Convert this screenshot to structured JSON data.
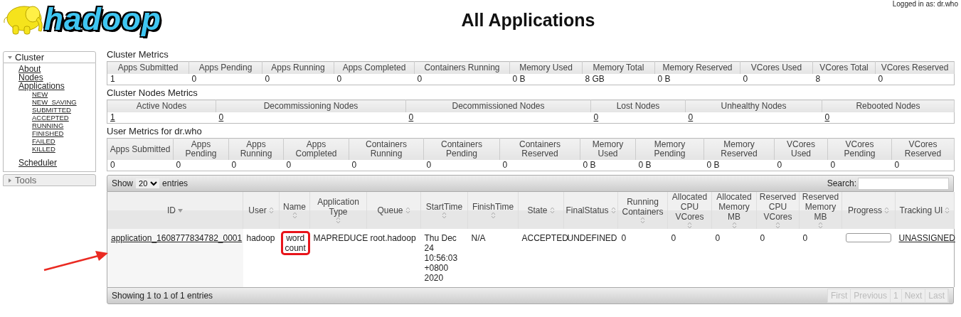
{
  "header": {
    "logo_text": "hadoop",
    "title": "All Applications",
    "login": "Logged in as: dr.who"
  },
  "sidebar": [
    {
      "label": "Cluster",
      "expanded": true,
      "items": [
        {
          "label": "About"
        },
        {
          "label": "Nodes"
        },
        {
          "label": "Applications",
          "children": [
            {
              "label": "NEW"
            },
            {
              "label": "NEW_SAVING"
            },
            {
              "label": "SUBMITTED"
            },
            {
              "label": "ACCEPTED"
            },
            {
              "label": "RUNNING"
            },
            {
              "label": "FINISHED"
            },
            {
              "label": "FAILED"
            },
            {
              "label": "KILLED"
            }
          ]
        },
        {
          "label": "Scheduler"
        }
      ]
    },
    {
      "label": "Tools",
      "expanded": false
    }
  ],
  "metrics": [
    {
      "title": "Cluster Metrics",
      "columns": [
        "Apps Submitted",
        "Apps Pending",
        "Apps Running",
        "Apps Completed",
        "Containers Running",
        "Memory Used",
        "Memory Total",
        "Memory Reserved",
        "VCores Used",
        "VCores Total",
        "VCores Reserved"
      ],
      "values": [
        "1",
        "0",
        "0",
        "0",
        "0",
        "0 B",
        "8 GB",
        "0 B",
        "0",
        "8",
        "0"
      ],
      "links": false
    },
    {
      "title": "Cluster Nodes Metrics",
      "columns": [
        "Active Nodes",
        "Decommissioning Nodes",
        "Decommissioned Nodes",
        "Lost Nodes",
        "Unhealthy Nodes",
        "Rebooted Nodes"
      ],
      "values": [
        "1",
        "0",
        "0",
        "0",
        "0",
        "0"
      ],
      "links": true
    },
    {
      "title": "User Metrics for dr.who",
      "columns": [
        "Apps Submitted",
        "Apps Pending",
        "Apps Running",
        "Apps Completed",
        "Containers Running",
        "Containers Pending",
        "Containers Reserved",
        "Memory Used",
        "Memory Pending",
        "Memory Reserved",
        "VCores Used",
        "VCores Pending",
        "VCores Reserved"
      ],
      "values": [
        "0",
        "0",
        "0",
        "0",
        "0",
        "0",
        "0",
        "0 B",
        "0 B",
        "0 B",
        "0",
        "0",
        "0"
      ],
      "links": false
    }
  ],
  "apps": {
    "show_label": "Show",
    "page_size": "20",
    "entries_label": "entries",
    "search_label": "Search:",
    "columns": [
      {
        "label": "ID",
        "sorted": true
      },
      {
        "label": "User",
        "sorted": false
      },
      {
        "label": "Name",
        "sorted": false
      },
      {
        "label": "Application Type",
        "sorted": false
      },
      {
        "label": "Queue",
        "sorted": false
      },
      {
        "label": "StartTime",
        "sorted": false
      },
      {
        "label": "FinishTime",
        "sorted": false
      },
      {
        "label": "State",
        "sorted": false
      },
      {
        "label": "FinalStatus",
        "sorted": false
      },
      {
        "label": "Running Containers",
        "sorted": false
      },
      {
        "label": "Allocated CPU VCores",
        "sorted": false
      },
      {
        "label": "Allocated Memory MB",
        "sorted": false
      },
      {
        "label": "Reserved CPU VCores",
        "sorted": false
      },
      {
        "label": "Reserved Memory MB",
        "sorted": false
      },
      {
        "label": "Progress",
        "sorted": false
      },
      {
        "label": "Tracking UI",
        "sorted": false
      }
    ],
    "rows": [
      [
        {
          "kind": "link",
          "text": "application_1608777834782_0001"
        },
        {
          "kind": "text",
          "text": "hadoop"
        },
        {
          "kind": "text",
          "text": "word count",
          "highlighted": true
        },
        {
          "kind": "text",
          "text": "MAPREDUCE"
        },
        {
          "kind": "text",
          "text": "root.hadoop"
        },
        {
          "kind": "text",
          "text": "Thu Dec 24 10:56:03 +0800 2020"
        },
        {
          "kind": "text",
          "text": "N/A"
        },
        {
          "kind": "text",
          "text": "ACCEPTED"
        },
        {
          "kind": "text",
          "text": "UNDEFINED"
        },
        {
          "kind": "text",
          "text": "0"
        },
        {
          "kind": "text",
          "text": "0"
        },
        {
          "kind": "text",
          "text": "0"
        },
        {
          "kind": "text",
          "text": "0"
        },
        {
          "kind": "text",
          "text": "0"
        },
        {
          "kind": "progress",
          "level": 0
        },
        {
          "kind": "link",
          "text": "UNASSIGNED"
        }
      ]
    ],
    "info": "Showing 1 to 1 of 1 entries",
    "pager": [
      {
        "label": "First",
        "disabled": true
      },
      {
        "label": "Previous",
        "disabled": true
      },
      {
        "label": "1",
        "disabled": true
      },
      {
        "label": "Next",
        "disabled": true
      },
      {
        "label": "Last",
        "disabled": true
      }
    ]
  },
  "annotation": {
    "arrow": true
  }
}
